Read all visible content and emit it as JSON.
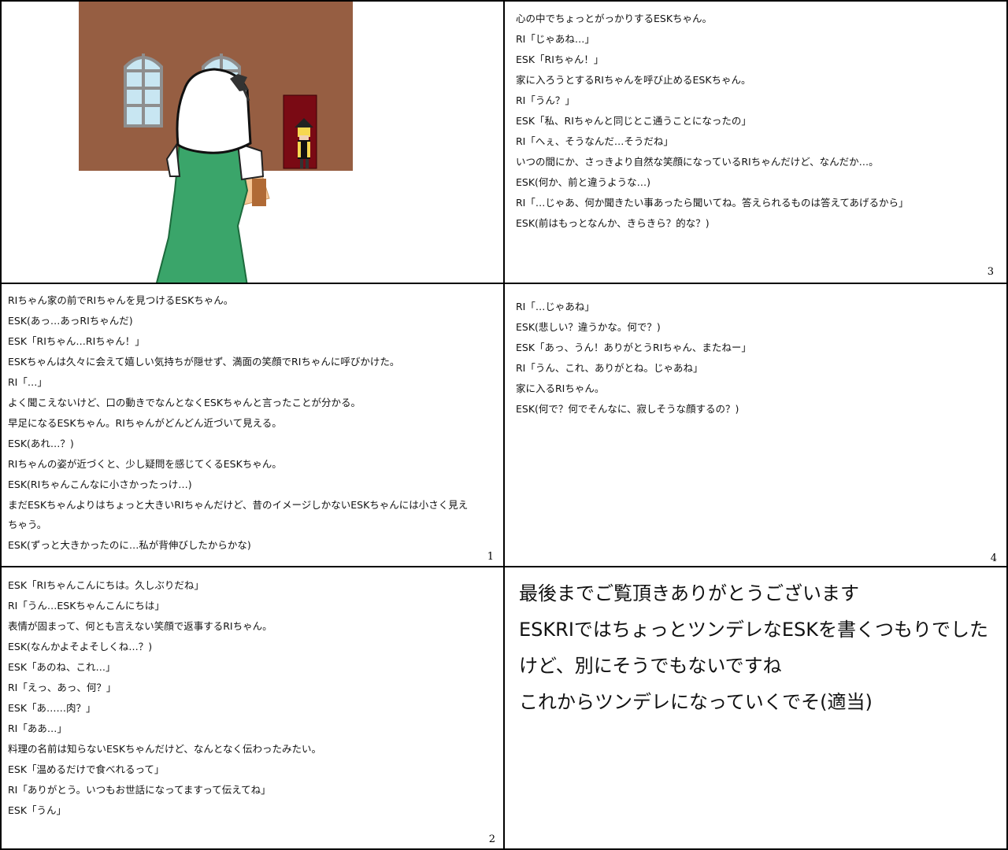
{
  "panels": {
    "tr": {
      "lines": [
        "心の中でちょっとがっかりするESKちゃん。",
        "RI「じゃあね…」",
        "ESK「RIちゃん！」",
        "家に入ろうとするRIちゃんを呼び止めるESKちゃん。",
        "RI「うん？」",
        "ESK「私、RIちゃんと同じとこ通うことになったの」",
        "RI「へぇ、そうなんだ…そうだね」",
        "いつの間にか、さっきより自然な笑顔になっているRIちゃんだけど、なんだか…。",
        "ESK(何か、前と違うような…)",
        "RI「…じゃあ、何か聞きたい事あったら聞いてね。答えられるものは答えてあげるから」",
        "ESK(前はもっとなんか、きらきら？的な？)"
      ],
      "page_number": "3"
    },
    "ml": {
      "lines": [
        "RIちゃん家の前でRIちゃんを見つけるESKちゃん。",
        "ESK(あっ…あっRIちゃんだ)",
        "ESK「RIちゃん…RIちゃん！」",
        "ESKちゃんは久々に会えて嬉しい気持ちが隠せず、満面の笑顔でRIちゃんに呼びかけた。",
        "RI「…」",
        "よく聞こえないけど、口の動きでなんとなくESKちゃんと言ったことが分かる。",
        "早足になるESKちゃん。RIちゃんがどんどん近づいて見える。",
        "ESK(あれ…？)",
        "RIちゃんの姿が近づくと、少し疑問を感じてくるESKちゃん。",
        "ESK(RIちゃんこんなに小さかったっけ…)",
        "まだESKちゃんよりはちょっと大きいRIちゃんだけど、昔のイメージしかないESKちゃんには小さく見え",
        "ちゃう。",
        "ESK(ずっと大きかったのに…私が背伸びしたからかな)"
      ],
      "page_number": "1"
    },
    "mr": {
      "lines": [
        "RI「…じゃあね」",
        "ESK(悲しい？違うかな。何で？)",
        "ESK「あっ、うん！ありがとうRIちゃん、またねー」",
        "RI「うん、これ、ありがとね。じゃあね」",
        "家に入るRIちゃん。",
        "ESK(何で？何でそんなに、寂しそうな顔するの？)"
      ],
      "page_number": "4"
    },
    "bl": {
      "lines": [
        "ESK「RIちゃんこんにちは。久しぶりだね」",
        "RI「うん…ESKちゃんこんにちは」",
        "表情が固まって、何とも言えない笑顔で返事するRIちゃん。",
        "ESK(なんかよそよそしくね…？)",
        "ESK「あのね、これ…」",
        "RI「えっ、あっ、何？」",
        "ESK「あ……肉？」",
        "RI「ああ…」",
        "料理の名前は知らないESKちゃんだけど、なんとなく伝わったみたい。",
        "ESK「温めるだけで食べれるって」",
        "RI「ありがとう。いつもお世話になってますって伝えてね」",
        "ESK「うん」"
      ],
      "page_number": "2"
    },
    "br": {
      "lines": [
        "最後までご覧頂きありがとうございます",
        "ESKRIではちょっとツンデレなESKを書くつもりでした",
        "けど、別にそうでもないですね",
        "これからツンデレになっていくでそ(適当)"
      ]
    }
  },
  "colors": {
    "wall": "#965e42",
    "window": "#c8e6f2",
    "door": "#7a0a14",
    "hair": "#ffffff",
    "dress": "#3aa56a"
  }
}
